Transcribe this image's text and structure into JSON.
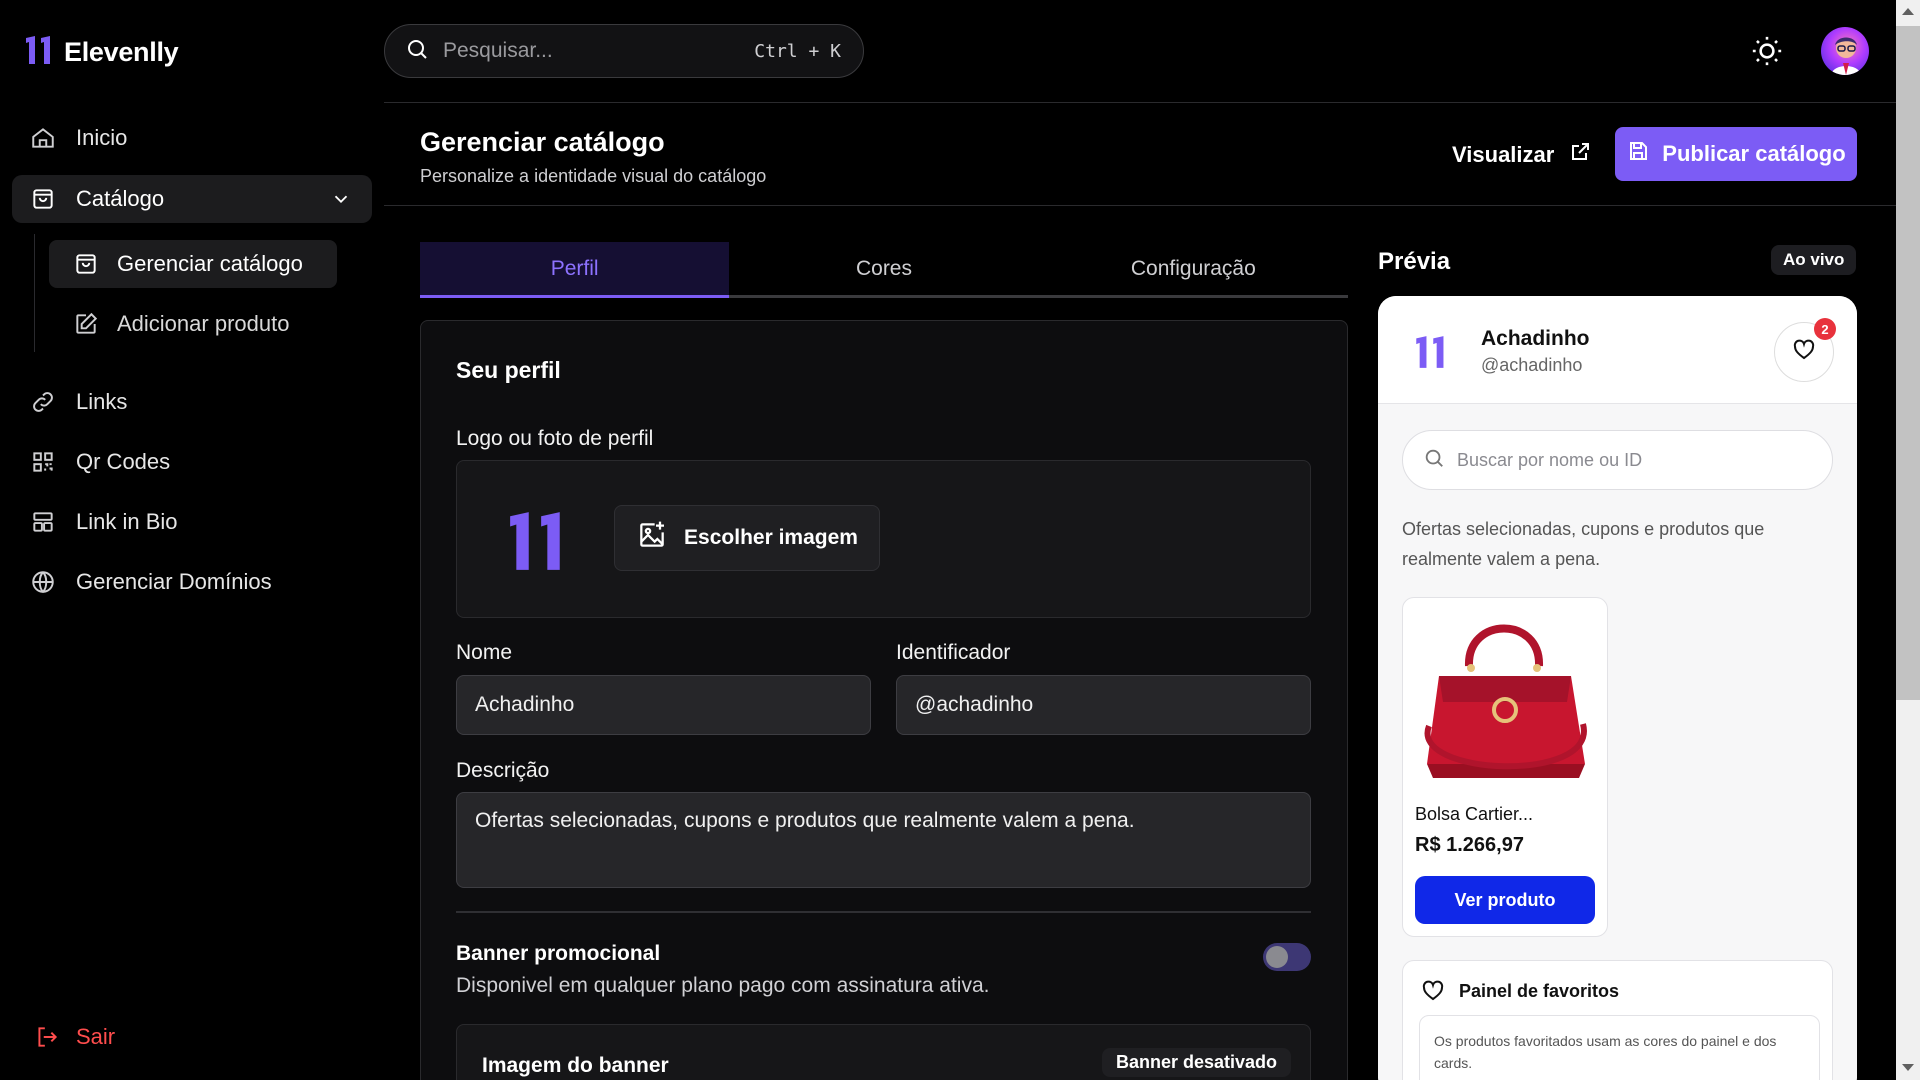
{
  "brand": {
    "name": "Elevenlly",
    "accent": "#7c5cf5"
  },
  "search": {
    "placeholder": "Pesquisar...",
    "shortcut": "Ctrl + K"
  },
  "sidebar": {
    "items": [
      {
        "label": "Inicio",
        "icon": "home-icon"
      },
      {
        "label": "Catálogo",
        "icon": "shopping-bag-icon",
        "expanded": true
      },
      {
        "label": "Links",
        "icon": "link-icon"
      },
      {
        "label": "Qr Codes",
        "icon": "qr-code-icon"
      },
      {
        "label": "Link in Bio",
        "icon": "layout-icon"
      },
      {
        "label": "Gerenciar Domínios",
        "icon": "globe-icon"
      }
    ],
    "sub_items": [
      {
        "label": "Gerenciar catálogo",
        "icon": "shopping-bag-icon",
        "active": true
      },
      {
        "label": "Adicionar produto",
        "icon": "edit-icon"
      }
    ],
    "logout_label": "Sair"
  },
  "header": {
    "title": "Gerenciar catálogo",
    "subtitle": "Personalize a identidade visual do catálogo",
    "view_label": "Visualizar",
    "publish_label": "Publicar catálogo"
  },
  "tabs": [
    {
      "label": "Perfil",
      "active": true
    },
    {
      "label": "Cores"
    },
    {
      "label": "Configuração"
    }
  ],
  "form": {
    "section_title": "Seu perfil",
    "logo_label": "Logo ou foto de perfil",
    "choose_image_label": "Escolher imagem",
    "name_label": "Nome",
    "name_value": "Achadinho",
    "id_label": "Identificador",
    "id_value": "@achadinho",
    "description_label": "Descrição",
    "description_value": "Ofertas selecionadas, cupons e produtos que realmente valem a pena.",
    "banner_title": "Banner promocional",
    "banner_sub": "Disponivel em qualquer plano pago com assinatura ativa.",
    "banner_enabled": false,
    "banner_image_label": "Imagem do banner",
    "banner_badge": "Banner desativado"
  },
  "preview": {
    "title": "Prévia",
    "live_badge": "Ao vivo",
    "store_name": "Achadinho",
    "store_handle": "@achadinho",
    "fav_count": "2",
    "search_placeholder": "Buscar por nome ou ID",
    "description": "Ofertas selecionadas, cupons e produtos que realmente valem a pena.",
    "product": {
      "name": "Bolsa Cartier...",
      "price": "R$ 1.266,97",
      "button": "Ver produto"
    },
    "fav_panel_title": "Painel de favoritos",
    "fav_panel_note": "Os produtos favoritados usam as cores do painel e dos cards."
  }
}
